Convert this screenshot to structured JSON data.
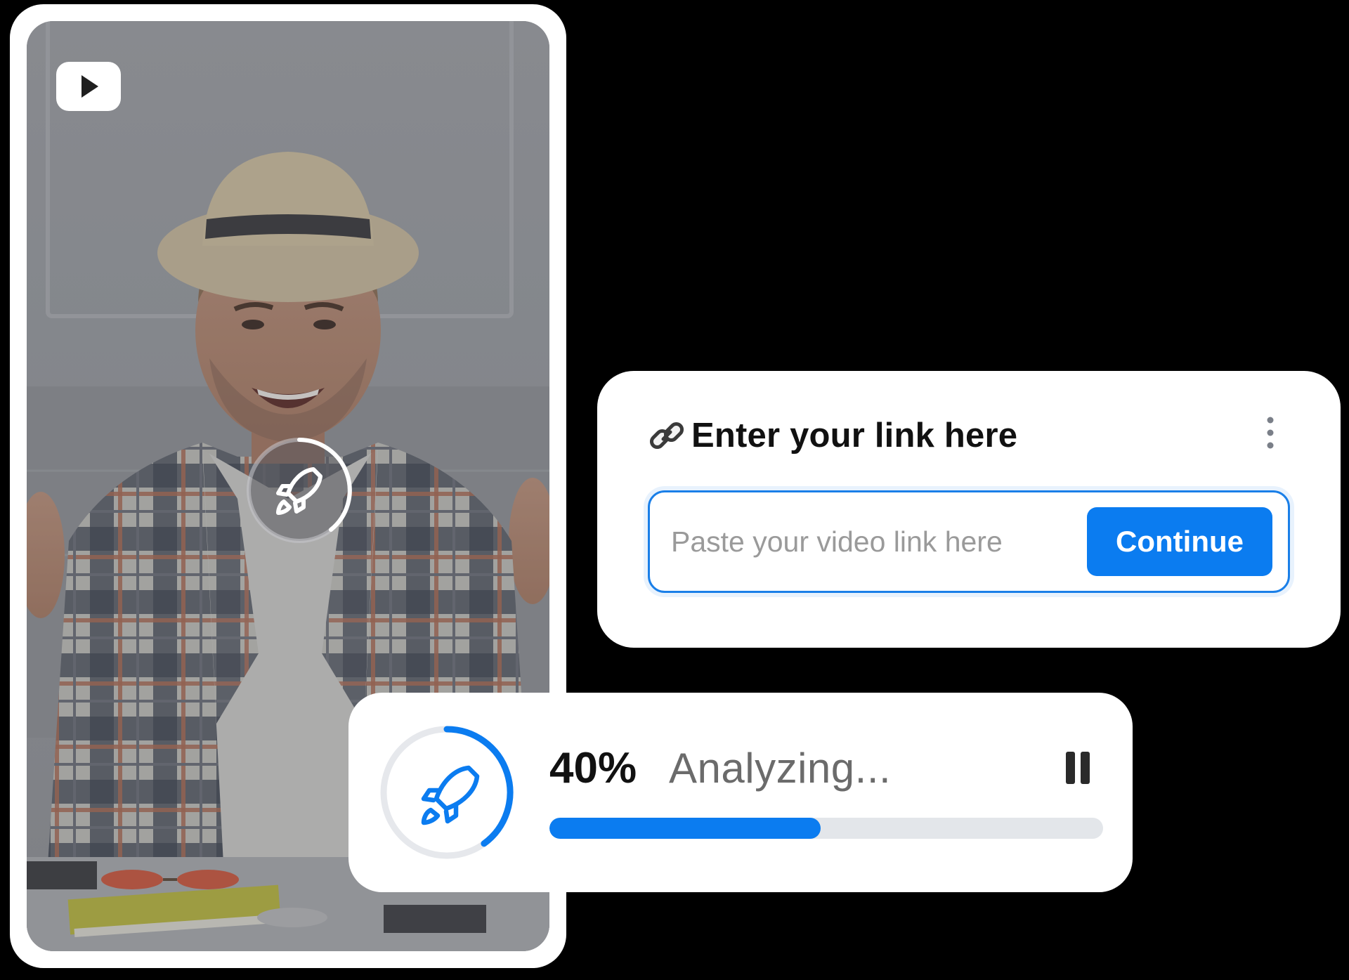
{
  "link_card": {
    "title": "Enter your link here",
    "input_placeholder": "Paste your video link here",
    "input_value": "",
    "continue_label": "Continue"
  },
  "progress_card": {
    "percent_label": "40%",
    "status": "Analyzing...",
    "progress_fraction": 0.49
  },
  "icons": {
    "video_platform": "youtube-logo-icon",
    "link": "link-chain-icon",
    "menu": "kebab-menu-icon",
    "loader": "rocket-icon",
    "pause": "pause-icon"
  },
  "colors": {
    "accent": "#0b7cf0",
    "track": "#e3e6ea",
    "background": "#000000",
    "card": "#ffffff"
  }
}
